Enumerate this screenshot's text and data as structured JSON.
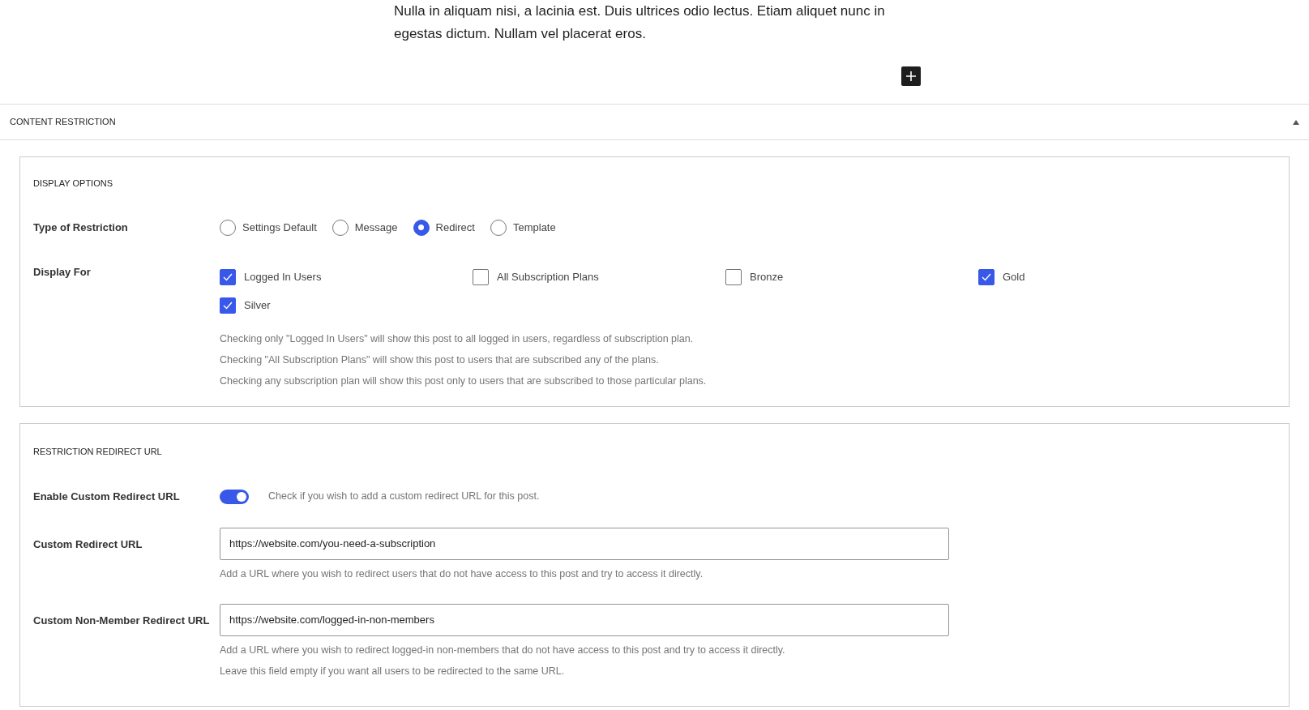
{
  "paragraph": "Nulla in aliquam nisi, a lacinia est. Duis ultrices odio lectus. Etiam aliquet nunc in egestas dictum. Nullam vel placerat eros.",
  "panel": {
    "title": "CONTENT RESTRICTION",
    "expanded": true
  },
  "display_options": {
    "heading": "DISPLAY OPTIONS",
    "type_label": "Type of Restriction",
    "restriction_types": [
      {
        "label": "Settings Default",
        "selected": false
      },
      {
        "label": "Message",
        "selected": false
      },
      {
        "label": "Redirect",
        "selected": true
      },
      {
        "label": "Template",
        "selected": false
      }
    ],
    "display_for_label": "Display For",
    "display_for": [
      {
        "label": "Logged In Users",
        "checked": true
      },
      {
        "label": "All Subscription Plans",
        "checked": false
      },
      {
        "label": "Bronze",
        "checked": false
      },
      {
        "label": "Gold",
        "checked": true
      },
      {
        "label": "Silver",
        "checked": true
      }
    ],
    "help": [
      "Checking only \"Logged In Users\" will show this post to all logged in users, regardless of subscription plan.",
      "Checking \"All Subscription Plans\" will show this post to users that are subscribed any of the plans.",
      "Checking any subscription plan will show this post only to users that are subscribed to those particular plans."
    ]
  },
  "redirect": {
    "heading": "RESTRICTION REDIRECT URL",
    "enable_label": "Enable Custom Redirect URL",
    "enable_on": true,
    "enable_help": "Check if you wish to add a custom redirect URL for this post.",
    "fields": [
      {
        "label": "Custom Redirect URL",
        "value": "https://website.com/you-need-a-subscription",
        "help": [
          "Add a URL where you wish to redirect users that do not have access to this post and try to access it directly."
        ]
      },
      {
        "label": "Custom Non-Member Redirect URL",
        "value": "https://website.com/logged-in-non-members",
        "help": [
          "Add a URL where you wish to redirect logged-in non-members that do not have access to this post and try to access it directly.",
          "Leave this field empty if you want all users to be redirected to the same URL."
        ]
      }
    ]
  }
}
